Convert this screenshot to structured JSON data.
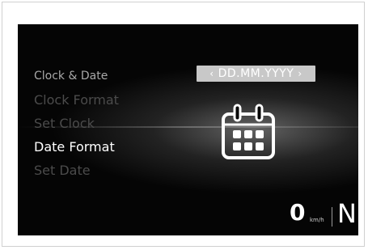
{
  "menu": {
    "title": "Clock & Date",
    "items": [
      {
        "label": "Clock Format",
        "state": "inactive"
      },
      {
        "label": "Set Clock",
        "state": "inactive"
      },
      {
        "label": "Date Format",
        "state": "selected"
      },
      {
        "label": "Set Date",
        "state": "inactive"
      }
    ]
  },
  "selector": {
    "left_arrow": "‹",
    "value": "DD.MM.YYYY",
    "right_arrow": "›"
  },
  "icon": "calendar-icon",
  "status": {
    "speed": "0",
    "unit": "km/h",
    "gear": "N"
  },
  "colors": {
    "background": "#050505",
    "selected_text": "#ffffff",
    "inactive_text": "#4b4b4b",
    "selector_bg": "#c8c8c8"
  }
}
